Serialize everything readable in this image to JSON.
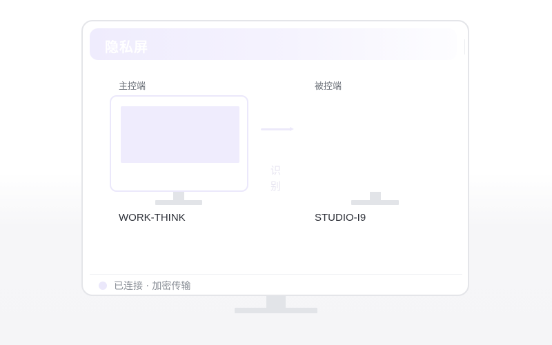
{
  "app": {
    "title": "隐私屏"
  },
  "host": {
    "role_label": "主控端",
    "device_name": "WORK-THINK"
  },
  "controlled": {
    "role_label": "被控端",
    "device_name": "STUDIO-I9"
  },
  "flow": {
    "recognize_chars": [
      "识",
      "别"
    ]
  },
  "status": {
    "text": "已连接 · 加密传输"
  },
  "colors": {
    "accent_light": "#efecfd",
    "monitor_stand": "#e2e4e8",
    "frame_border": "#e4e5e9",
    "text_primary": "#2d3038",
    "text_secondary": "#6b7078"
  }
}
